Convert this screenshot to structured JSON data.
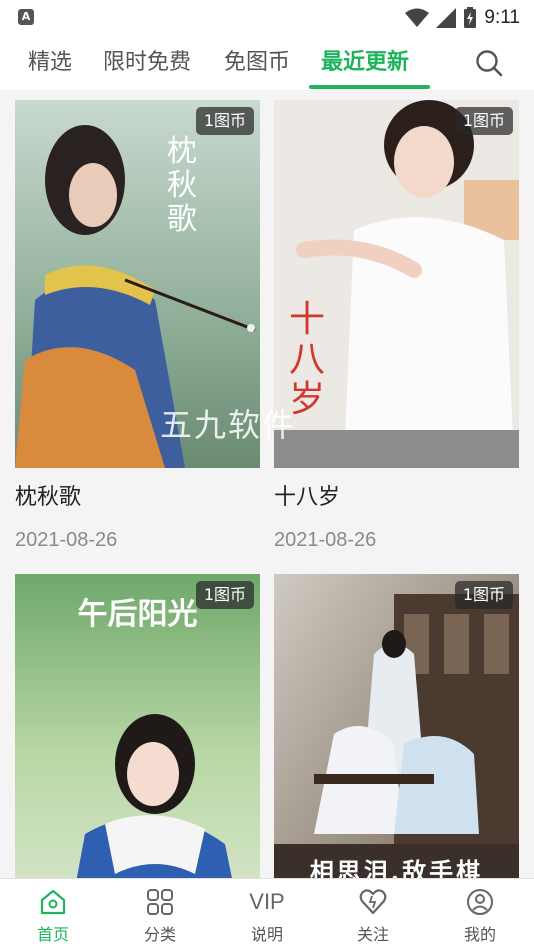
{
  "status_bar": {
    "time": "9:11",
    "notification_icon": "a-notification-icon"
  },
  "top_tabs": [
    {
      "label": "精选",
      "active": false
    },
    {
      "label": "限时免费",
      "active": false
    },
    {
      "label": "免图币",
      "active": false
    },
    {
      "label": "最近更新",
      "active": true
    }
  ],
  "accent_color": "#1fb35c",
  "cards": [
    {
      "title": "枕秋歌",
      "date": "2021-08-26",
      "badge": "1图币",
      "poster_text": "枕秋歌"
    },
    {
      "title": "十八岁",
      "date": "2021-08-26",
      "badge": "1图币",
      "poster_text": "十八岁"
    },
    {
      "title": "",
      "date": "",
      "badge": "1图币",
      "poster_text": "午后阳光"
    },
    {
      "title": "",
      "date": "",
      "badge": "1图币",
      "poster_text": "相思泪.敌手棋"
    }
  ],
  "watermark": "五九软件",
  "bottom_nav": [
    {
      "label": "首页",
      "icon": "home-icon",
      "active": true
    },
    {
      "label": "分类",
      "icon": "grid-icon",
      "active": false
    },
    {
      "label": "说明",
      "icon": "vip-text-icon",
      "icon_text": "VIP",
      "active": false
    },
    {
      "label": "关注",
      "icon": "heart-icon",
      "active": false
    },
    {
      "label": "我的",
      "icon": "user-icon",
      "active": false
    }
  ]
}
